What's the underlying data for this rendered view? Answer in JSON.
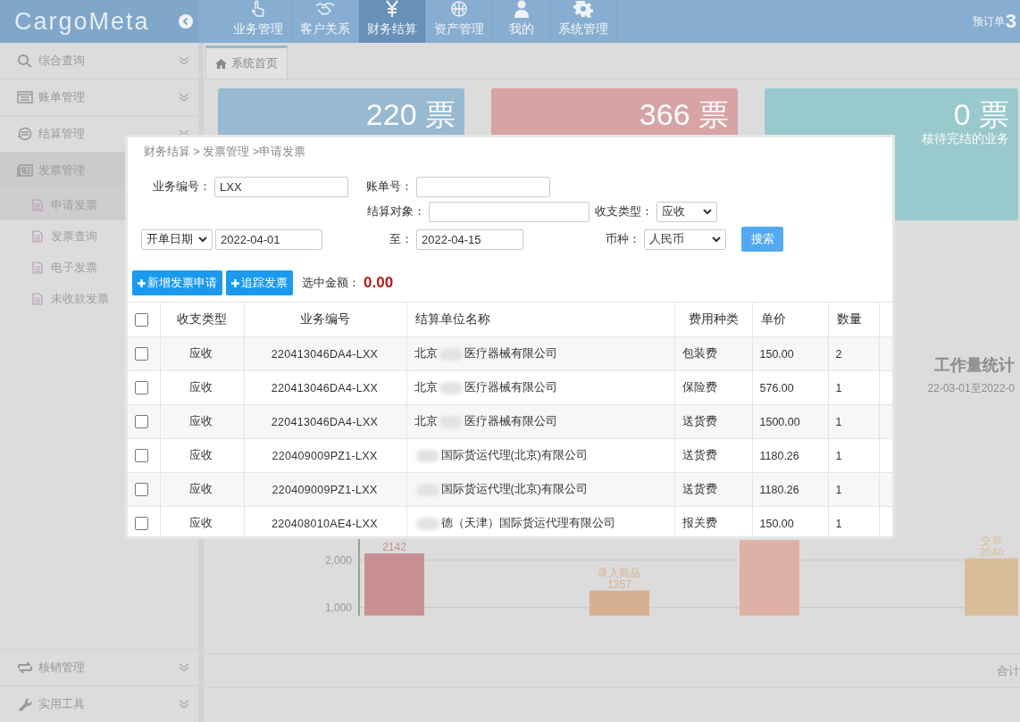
{
  "header": {
    "logo": "CargoMeta",
    "nav": [
      {
        "label": "业务管理",
        "selected": false
      },
      {
        "label": "客户关系",
        "selected": false
      },
      {
        "label": "财务结算",
        "selected": true
      },
      {
        "label": "资产管理",
        "selected": false
      },
      {
        "label": "我的",
        "selected": false
      },
      {
        "label": "系统管理",
        "selected": false
      }
    ],
    "order_label": "预订单",
    "order_count": "3"
  },
  "sidebar": {
    "items": [
      {
        "label": "综合查询",
        "selected": false,
        "expanded": false
      },
      {
        "label": "账单管理",
        "selected": false,
        "expanded": false
      },
      {
        "label": "结算管理",
        "selected": false,
        "expanded": false
      },
      {
        "label": "发票管理",
        "selected": true,
        "expanded": true,
        "children": [
          {
            "label": "申请发票",
            "selected": true
          },
          {
            "label": "发票查询",
            "selected": false
          },
          {
            "label": "电子发票",
            "selected": false
          },
          {
            "label": "未收款发票",
            "selected": false
          }
        ]
      }
    ],
    "bottom_items": [
      {
        "label": "核销管理"
      },
      {
        "label": "实用工具"
      }
    ]
  },
  "tabs": [
    {
      "label": "系统首页",
      "selected": true
    }
  ],
  "cards": [
    {
      "value": "220 票",
      "color": "#97b9d1"
    },
    {
      "value": "366 票",
      "color": "#d7a3a5"
    },
    {
      "value": "0 票",
      "caption": "核待完结的业务",
      "color": "#98c9cc"
    }
  ],
  "workload": {
    "title": "工作量统计",
    "range": "22-03-01至2022-0",
    "chart_data": {
      "type": "bar",
      "ylim": [
        830,
        2560
      ],
      "yticks": [
        {
          "value": 1000,
          "label": "1,000"
        },
        {
          "value": 2000,
          "label": "2,000"
        }
      ],
      "values": [
        2142,
        1357,
        2420,
        2040
      ],
      "value_labels": [
        "2142",
        "1357",
        null,
        "2040"
      ],
      "annotations": [
        null,
        "录入商品",
        null,
        "交单"
      ]
    }
  },
  "summary_label": "合计",
  "dialog": {
    "breadcrumb": "财务结算 > 发票管理 >申请发票",
    "form": {
      "business_no_label": "业务编号：",
      "business_no": "LXX",
      "bill_no_label": "账单号：",
      "party_label": "结算对象：",
      "type_label": "收支类型：",
      "type_value": "应收",
      "date_kind": "开单日期",
      "date_from": "2022-04-01",
      "to_label": "至：",
      "date_to": "2022-04-15",
      "currency_label": "币种：",
      "currency": "人民币",
      "search": "搜索"
    },
    "actions": [
      "新增发票申请",
      "追踪发票"
    ],
    "amount_label": "选中金额：",
    "amount": "0.00",
    "table": {
      "columns": [
        "收支类型",
        "业务编号",
        "结算单位名称",
        "费用种类",
        "单价",
        "数量"
      ],
      "header_checked": false,
      "rows": [
        {
          "checked": false,
          "type": "应收",
          "no": "220413046DA4-LXX",
          "name_before": "北京",
          "name_after": "医疗器械有限公司",
          "fee": "包装费",
          "price": "150.00",
          "qty": "2"
        },
        {
          "checked": false,
          "type": "应收",
          "no": "220413046DA4-LXX",
          "name_before": "北京",
          "name_after": "医疗器械有限公司",
          "fee": "保险费",
          "price": "576.00",
          "qty": "1"
        },
        {
          "checked": false,
          "type": "应收",
          "no": "220413046DA4-LXX",
          "name_before": "北京",
          "name_after": "医疗器械有限公司",
          "fee": "送货费",
          "price": "1500.00",
          "qty": "1"
        },
        {
          "checked": false,
          "type": "应收",
          "no": "220409009PZ1-LXX",
          "name_after": "国际货运代理(北京)有限公司",
          "fee": "送货费",
          "price": "1180.26",
          "qty": "1"
        },
        {
          "checked": false,
          "type": "应收",
          "no": "220409009PZ1-LXX",
          "name_after": "国际货运代理(北京)有限公司",
          "fee": "送货费",
          "price": "1180.26",
          "qty": "1"
        },
        {
          "checked": false,
          "type": "应收",
          "no": "220408010AE4-LXX",
          "name_after": "德（天津）国际货运代理有限公司",
          "fee": "报关费",
          "price": "150.00",
          "qty": "1"
        }
      ]
    }
  }
}
